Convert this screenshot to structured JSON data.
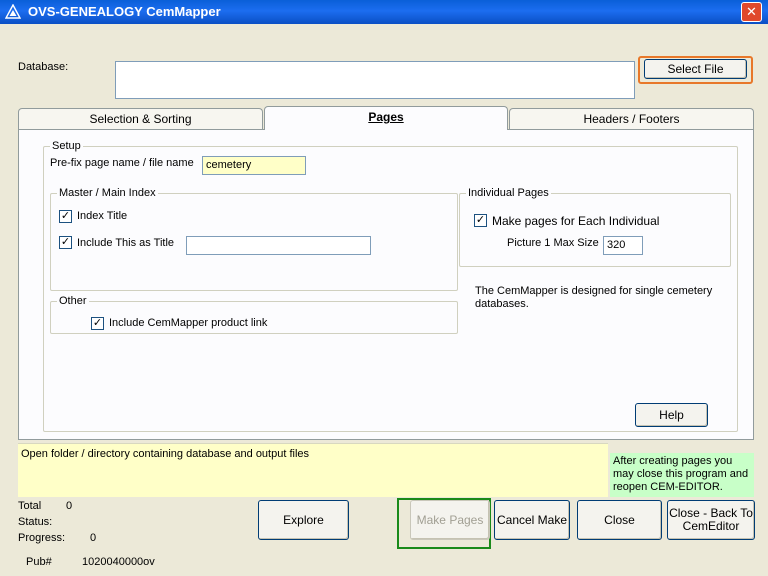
{
  "window": {
    "title": "OVS-GENEALOGY  CemMapper",
    "close_glyph": "✕"
  },
  "database": {
    "label": "Database:",
    "value": "",
    "select_file_label": "Select File"
  },
  "tabs": [
    {
      "label": "Selection & Sorting",
      "active": false
    },
    {
      "label": "Pages",
      "active": true
    },
    {
      "label": "Headers / Footers",
      "active": false
    }
  ],
  "setup": {
    "legend": "Setup",
    "prefix_label": "Pre-fix page name / file name",
    "prefix_value": "cemetery"
  },
  "master_index": {
    "legend": "Master  / Main Index",
    "index_title_label": "Index Title",
    "index_title_checked": true,
    "include_title_label": "Include This as Title",
    "include_title_checked": true,
    "include_title_value": ""
  },
  "individual_pages": {
    "legend": "Individual Pages",
    "make_pages_label": "Make pages for Each Individual",
    "make_pages_checked": true,
    "picture_max_label": "Picture 1 Max Size",
    "picture_max_value": "320"
  },
  "other": {
    "legend": "Other",
    "product_link_label": "Include  CemMapper product link",
    "product_link_checked": true
  },
  "info_text": "The CemMapper is designed for single cemetery databases.",
  "help_label": "Help",
  "status_message": "Open folder / directory containing database and output files",
  "tip_text": "After creating pages you may close this program and reopen CEM-EDITOR.",
  "stats": {
    "total_label": "Total",
    "total_value": "0",
    "status_label": "Status:",
    "status_value": "",
    "progress_label": "Progress:",
    "progress_value": "0",
    "pub_label": "Pub#",
    "pub_value": "1020040000ov"
  },
  "buttons": {
    "explore": "Explore",
    "make_pages": "Make Pages",
    "cancel_make": "Cancel Make",
    "close": "Close",
    "close_back": "Close - Back To CemEditor"
  },
  "check_glyph": "✓",
  "colors": {
    "highlight_orange": "#e8782a",
    "highlight_green": "#1a8a1a",
    "status_yellow": "#ffffc8",
    "tip_green": "#c8ffc8"
  }
}
